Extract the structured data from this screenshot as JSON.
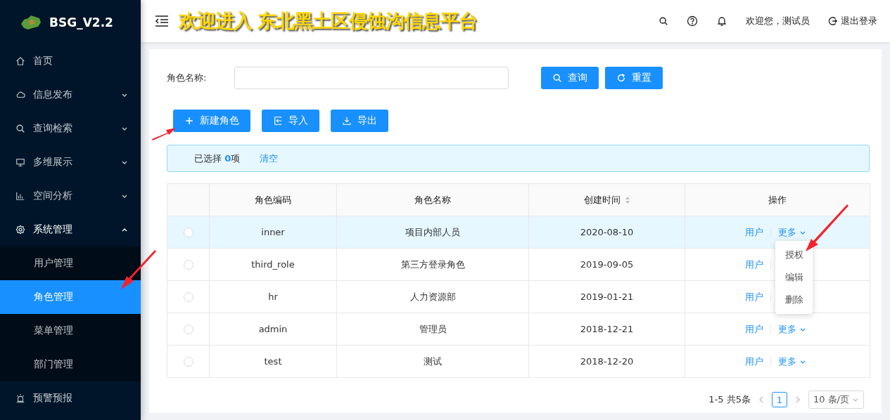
{
  "sidebar": {
    "logo_text": "BSG_V2.2",
    "items": [
      {
        "label": "首页",
        "kind": "item"
      },
      {
        "label": "信息发布",
        "kind": "submenu",
        "expanded": false
      },
      {
        "label": "查询检索",
        "kind": "submenu",
        "expanded": false
      },
      {
        "label": "多维展示",
        "kind": "submenu",
        "expanded": false
      },
      {
        "label": "空间分析",
        "kind": "submenu",
        "expanded": false
      },
      {
        "label": "系统管理",
        "kind": "submenu",
        "expanded": true,
        "children": [
          {
            "label": "用户管理",
            "selected": false
          },
          {
            "label": "角色管理",
            "selected": true
          },
          {
            "label": "菜单管理",
            "selected": false
          },
          {
            "label": "部门管理",
            "selected": false
          }
        ]
      },
      {
        "label": "预警预报",
        "kind": "item"
      }
    ]
  },
  "header": {
    "title": "欢迎进入 东北黑土区侵蚀沟信息平台",
    "welcome": "欢迎您，测试员",
    "logout": "退出登录"
  },
  "search_form": {
    "label": "角色名称:",
    "buttons": [
      "查询",
      "重置"
    ]
  },
  "toolbar": [
    "新建角色",
    "导入",
    "导出"
  ],
  "selection_alert": {
    "prefix": "已选择",
    "count": "0",
    "suffix": "项",
    "clear": "清空"
  },
  "table": {
    "columns": [
      "角色编码",
      "角色名称",
      "创建时间",
      "操作"
    ],
    "rows": [
      {
        "code": "inner",
        "name": "项目内部人员",
        "created": "2020-08-10",
        "hovered": true,
        "selected": false,
        "actions": [
          {
            "label": "用户",
            "kind": "link"
          },
          {
            "label": "更多",
            "kind": "dropdown"
          }
        ]
      },
      {
        "code": "third_role",
        "name": "第三方登录角色",
        "created": "2019-09-05",
        "hovered": false,
        "selected": false,
        "actions": [
          {
            "label": "用户",
            "kind": "link"
          }
        ]
      },
      {
        "code": "hr",
        "name": "人力资源部",
        "created": "2019-01-21",
        "hovered": false,
        "selected": false,
        "actions": [
          {
            "label": "用户",
            "kind": "link"
          }
        ]
      },
      {
        "code": "admin",
        "name": "管理员",
        "created": "2018-12-21",
        "hovered": false,
        "selected": false,
        "actions": [
          {
            "label": "用户",
            "kind": "link"
          },
          {
            "label": "更多",
            "kind": "dropdown"
          }
        ]
      },
      {
        "code": "test",
        "name": "测试",
        "created": "2018-12-20",
        "hovered": false,
        "selected": false,
        "actions": [
          {
            "label": "用户",
            "kind": "link"
          },
          {
            "label": "更多",
            "kind": "dropdown"
          }
        ]
      }
    ]
  },
  "dropdown": {
    "items": [
      "授权",
      "编辑",
      "删除"
    ]
  },
  "pagination": {
    "summary": "1-5 共5条",
    "pages": [
      {
        "label": "1",
        "selected": true
      }
    ],
    "page_size": "10 条/页"
  }
}
